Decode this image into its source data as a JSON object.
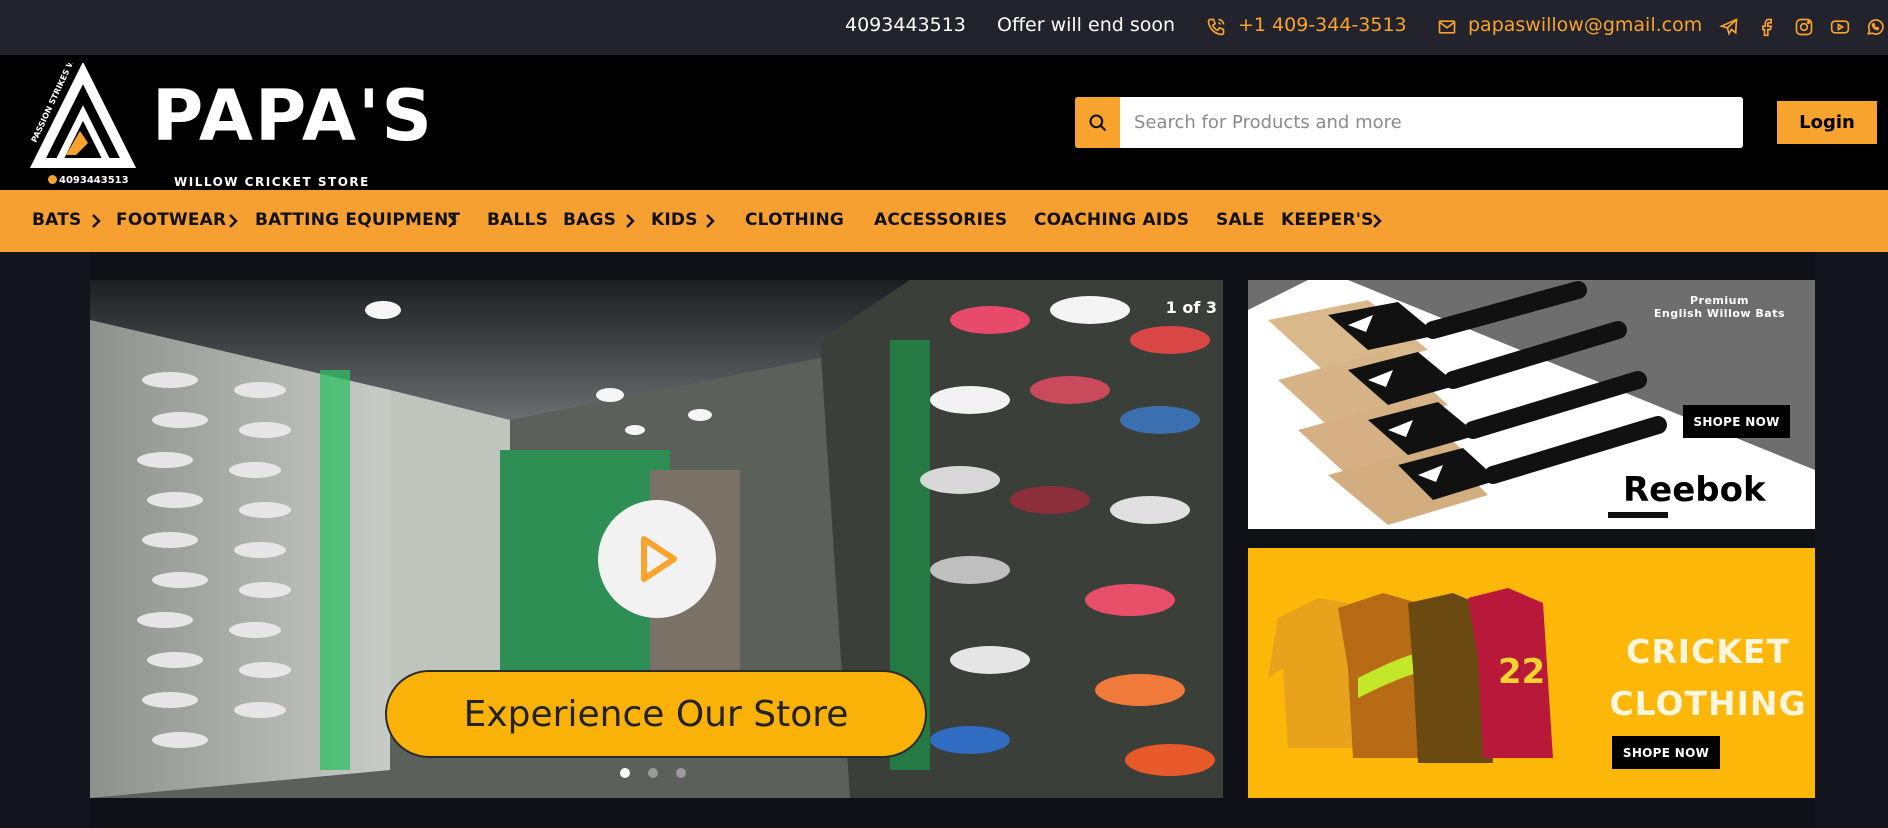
{
  "topbar": {
    "phone_plain": "4093443513",
    "offer": "Offer will end soon",
    "phone_link": "+1 409-344-3513",
    "email": "papaswillow@gmail.com",
    "icons": [
      "phone-icon",
      "mail-icon",
      "telegram-icon",
      "facebook-icon",
      "instagram-icon",
      "youtube-icon",
      "whatsapp-icon"
    ]
  },
  "logo": {
    "word": "PAPA'S",
    "tagline": "WILLOW CRICKET STORE",
    "phone": "4093443513",
    "arc_text": "PASSION STRIKES WILLOW"
  },
  "search": {
    "placeholder": "Search for Products and more"
  },
  "login": "Login",
  "nav": {
    "items": [
      {
        "label": "BATS"
      },
      {
        "label": "FOOTWEAR"
      },
      {
        "label": "BATTING EQUIPMENT"
      },
      {
        "label": "BALLS"
      },
      {
        "label": "BAGS"
      },
      {
        "label": "KIDS"
      },
      {
        "label": "CLOTHING"
      },
      {
        "label": "ACCESSORIES"
      },
      {
        "label": "COACHING AIDS"
      },
      {
        "label": "SALE"
      },
      {
        "label": "KEEPER'S"
      }
    ]
  },
  "slider": {
    "counter": "1 of 3",
    "cta": "Experience Our Store",
    "total_slides": 3,
    "active_slide": 1
  },
  "banners": {
    "bats": {
      "premium_line1": "Premium",
      "premium_line2": "English Willow Bats",
      "shop": "SHOPE NOW",
      "brand": "Reebok"
    },
    "clothing": {
      "line1": "CRICKET",
      "line2": "CLOTHING",
      "shop": "SHOPE NOW",
      "jersey_number": "22"
    }
  },
  "colors": {
    "accent": "#f7a32e",
    "topbar_bg": "#22232c",
    "header_bg": "#000000",
    "page_bg": "#14151c"
  }
}
